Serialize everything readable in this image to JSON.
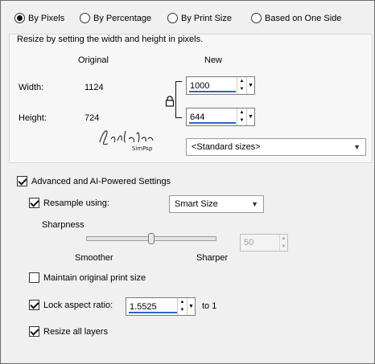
{
  "mode": {
    "options": [
      "By Pixels",
      "By Percentage",
      "By Print Size",
      "Based on One Side"
    ],
    "selected": "By Pixels"
  },
  "resize_section": {
    "caption": "Resize by setting the width and height in pixels.",
    "col_original": "Original",
    "col_new": "New",
    "width_label": "Width:",
    "height_label": "Height:",
    "width_original": "1124",
    "height_original": "724",
    "width_new": "1000",
    "height_new": "644",
    "watermark": "Sari Kilem SimPsp",
    "standard_sizes": "<Standard sizes>"
  },
  "advanced": {
    "label": "Advanced and AI-Powered Settings",
    "checked": true,
    "resample_label": "Resample using:",
    "resample_checked": true,
    "resample_method": "Smart Size",
    "sharpness_label": "Sharpness",
    "smoother_label": "Smoother",
    "sharper_label": "Sharper",
    "sharpness_value": "50",
    "sharpness_fraction": 0.5
  },
  "maintain_print": {
    "label": "Maintain original print size",
    "checked": false
  },
  "lock_aspect": {
    "label": "Lock aspect ratio:",
    "checked": true,
    "value": "1.5525",
    "suffix": "to 1"
  },
  "resize_layers": {
    "label": "Resize all layers",
    "checked": true
  },
  "colors": {
    "accent": "#2a66c3",
    "panel_bg": "#f7f7f7",
    "window_bg": "#f0f0f0"
  }
}
